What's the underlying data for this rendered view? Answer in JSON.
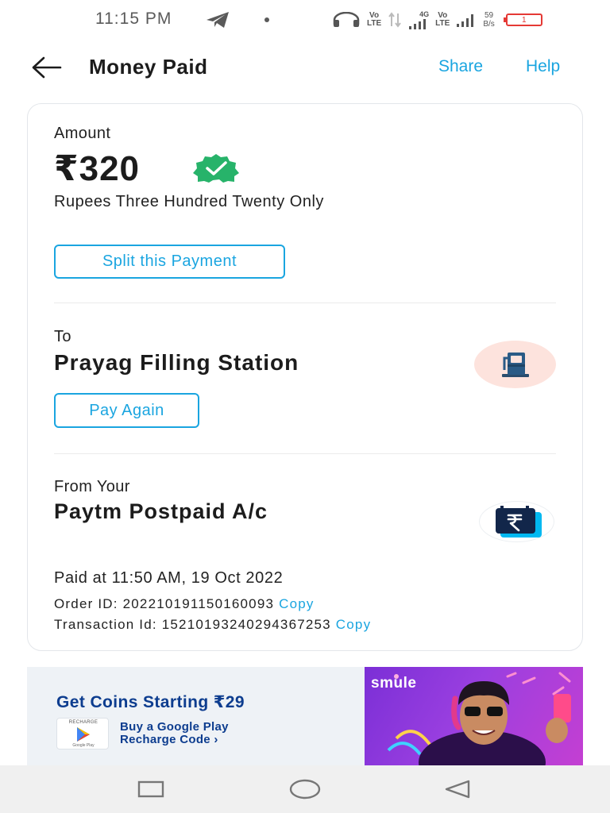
{
  "status_bar": {
    "time": "11:15 PM",
    "lte1": [
      "Vo",
      "LTE"
    ],
    "net_type": "4G",
    "lte2": [
      "Vo",
      "LTE"
    ],
    "speed": [
      "59",
      "B/s"
    ],
    "battery_level": "1"
  },
  "header": {
    "title": "Money Paid",
    "share_label": "Share",
    "help_label": "Help"
  },
  "payment": {
    "amount_label": "Amount",
    "amount": "₹320",
    "amount_words": "Rupees Three Hundred Twenty Only",
    "split_button": "Split this Payment",
    "to_label": "To",
    "payee": "Prayag Filling Station",
    "pay_again_button": "Pay Again",
    "from_label": "From Your",
    "account": "Paytm Postpaid A/c",
    "paid_at": "Paid at 11:50 AM, 19 Oct 2022",
    "order_id_label": "Order ID: ",
    "order_id": "202210191150160093",
    "transaction_id_label": "Transaction Id: ",
    "transaction_id": "15210193240294367253",
    "copy_label": "Copy"
  },
  "ad": {
    "headline": "Get Coins Starting ₹29",
    "badge_top": "RECHARGE",
    "badge_bottom": "Google Play",
    "sub_line1": "Buy a Google Play",
    "sub_line2": "Recharge Code ›",
    "brand": "smule"
  },
  "colors": {
    "accent": "#1aa5e0",
    "verified_green": "#27b36a",
    "ad_blue": "#0d3d8f",
    "battery_red": "#e53935"
  },
  "icons": {
    "back": "arrow-left-icon",
    "verified": "verified-badge-icon",
    "payee": "fuel-pump-icon",
    "account": "rupee-wallet-icon",
    "nav_recent": "square-icon",
    "nav_home": "circle-icon",
    "nav_back": "triangle-back-icon"
  }
}
